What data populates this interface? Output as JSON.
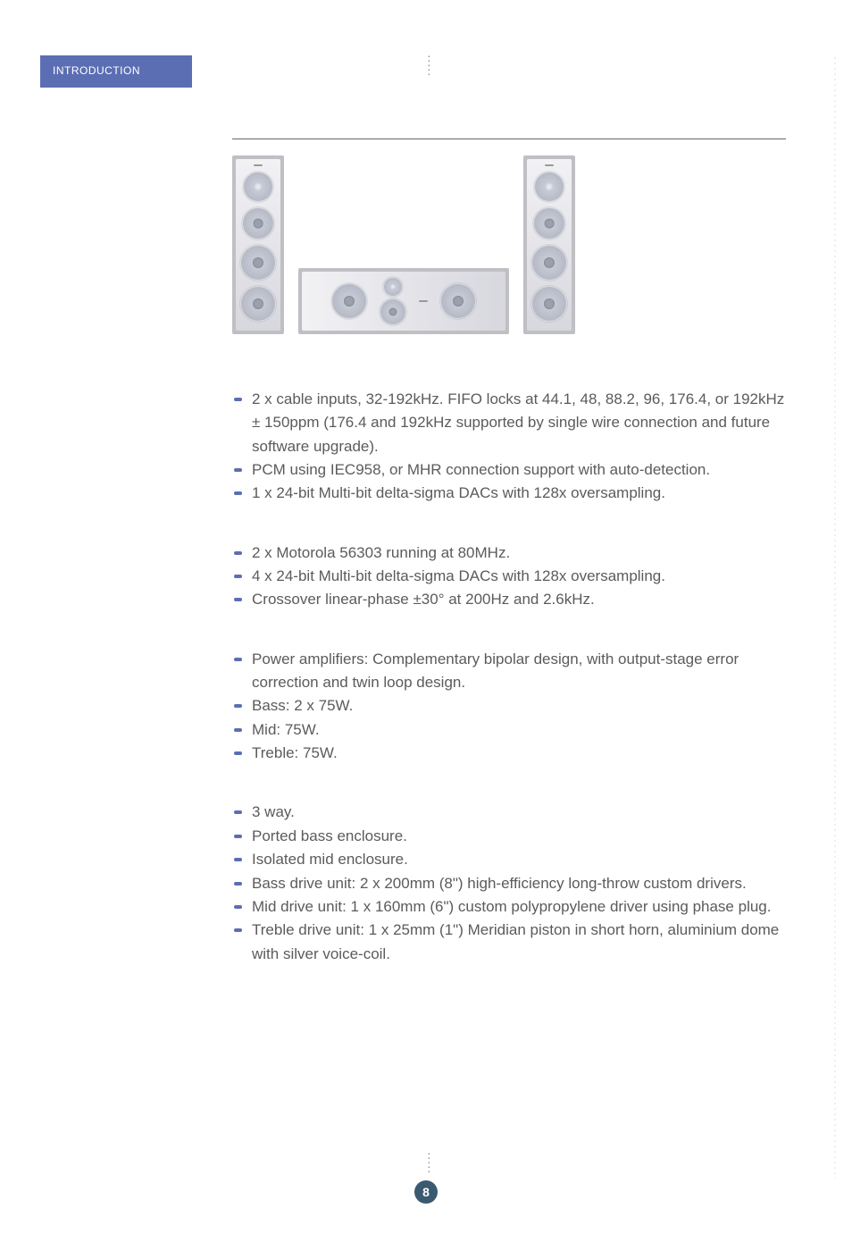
{
  "sidebar": {
    "label": "INTRODUCTION"
  },
  "sections": {
    "inputs": [
      "2 x cable inputs, 32-192kHz. FIFO locks at 44.1, 48, 88.2, 96, 176.4, or 192kHz ± 150ppm (176.4 and 192kHz supported by single wire connection and future software upgrade).",
      "PCM using IEC958, or MHR connection support with auto-detection.",
      "1 x 24-bit Multi-bit delta-sigma DACs with 128x oversampling."
    ],
    "dsp": [
      "2 x Motorola 56303 running at 80MHz.",
      "4 x 24-bit Multi-bit delta-sigma DACs with 128x oversampling.",
      "Crossover linear-phase ±30° at 200Hz and 2.6kHz."
    ],
    "amps": [
      "Power amplifiers: Complementary bipolar design, with output-stage error correction and twin loop design.",
      "Bass: 2 x 75W.",
      "Mid: 75W.",
      "Treble: 75W."
    ],
    "drivers": [
      "3 way.",
      "Ported bass enclosure.",
      "Isolated mid enclosure.",
      "Bass drive unit: 2 x 200mm (8\") high-efficiency long-throw custom drivers.",
      "Mid drive unit: 1 x 160mm (6\") custom polypropylene driver using phase plug.",
      "Treble drive unit: 1 x 25mm (1\") Meridian piston in short horn, aluminium dome with silver voice-coil."
    ]
  },
  "page_number": "8"
}
